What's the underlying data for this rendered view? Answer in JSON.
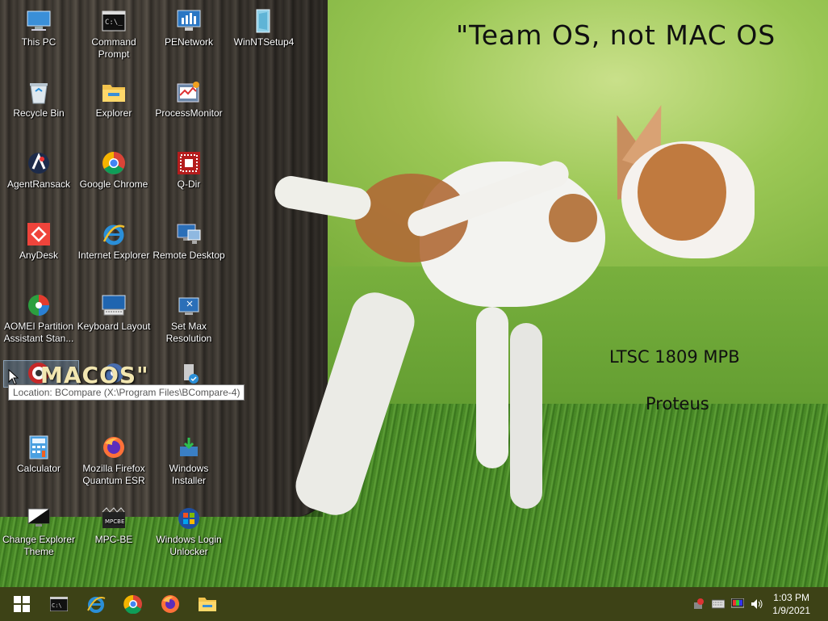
{
  "wallpaper": {
    "title": "\"Team OS, not MAC OS",
    "edition": "LTSC 1809 MPB",
    "author": "Proteus"
  },
  "desktop_icons": [
    {
      "label": "This PC",
      "icon": "this-pc-icon"
    },
    {
      "label": "Command Prompt",
      "icon": "command-prompt-icon"
    },
    {
      "label": "PENetwork",
      "icon": "penetwork-icon"
    },
    {
      "label": "WinNTSetup4",
      "icon": "winntsetup-icon"
    },
    {
      "label": "Recycle Bin",
      "icon": "recycle-bin-icon"
    },
    {
      "label": "Explorer",
      "icon": "folder-icon"
    },
    {
      "label": "ProcessMonitor",
      "icon": "process-monitor-icon"
    },
    {
      "label": "AgentRansack",
      "icon": "agent-ransack-icon"
    },
    {
      "label": "Google Chrome",
      "icon": "chrome-icon"
    },
    {
      "label": "Q-Dir",
      "icon": "q-dir-icon"
    },
    {
      "label": "AnyDesk",
      "icon": "anydesk-icon"
    },
    {
      "label": "Internet Explorer",
      "icon": "internet-explorer-icon"
    },
    {
      "label": "Remote Desktop",
      "icon": "remote-desktop-icon"
    },
    {
      "label": "AOMEI Partition Assistant Stan...",
      "icon": "aomei-icon"
    },
    {
      "label": "Keyboard Layout",
      "icon": "keyboard-icon"
    },
    {
      "label": "Set Max Resolution",
      "icon": "set-resolution-icon"
    },
    {
      "label": "Calculator",
      "icon": "calculator-icon"
    },
    {
      "label": "Mozilla Firefox Quantum ESR",
      "icon": "firefox-icon"
    },
    {
      "label": "Windows Installer",
      "icon": "windows-installer-icon"
    },
    {
      "label": "Change Explorer Theme",
      "icon": "change-theme-icon"
    },
    {
      "label": "MPC-BE",
      "icon": "mpc-be-icon"
    },
    {
      "label": "Windows Login Unlocker",
      "icon": "windows-login-unlocker-icon"
    }
  ],
  "drag": {
    "ghost_text": "MACOS\"",
    "tooltip": "Location: BCompare (X:\\Program Files\\BCompare-4)"
  },
  "taskbar": {
    "items": [
      "start-button",
      "command-prompt",
      "internet-explorer",
      "chrome",
      "firefox",
      "file-explorer"
    ],
    "clock_time": "1:03 PM",
    "clock_date": "1/9/2021"
  },
  "colors": {
    "taskbar": "#3d4216",
    "tooltip_border": "#767676"
  }
}
